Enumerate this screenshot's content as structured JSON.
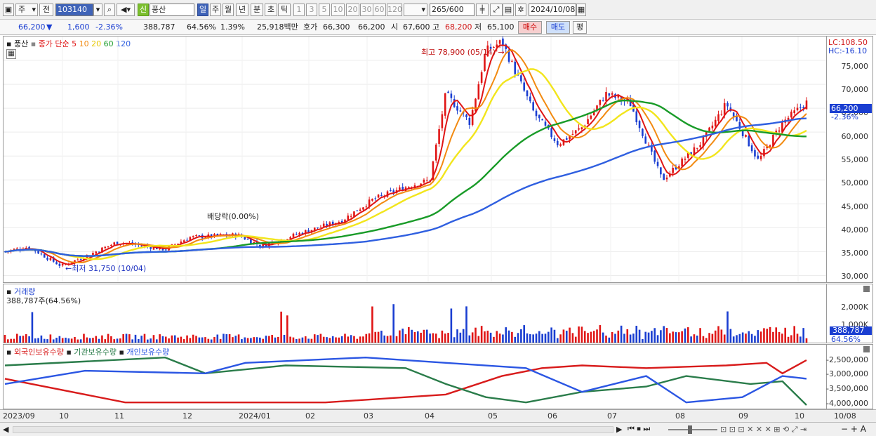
{
  "toolbar": {
    "market": "주",
    "prev_label": "전",
    "code": "103140",
    "news_badge": "신",
    "stock_name": "풍산",
    "periods": [
      "일",
      "주",
      "월",
      "년",
      "분",
      "초",
      "틱"
    ],
    "minutes": [
      "1",
      "3",
      "5",
      "10",
      "20",
      "30",
      "60",
      "120"
    ],
    "count": "265",
    "count_total": "/600",
    "date": "2024/10/08"
  },
  "quote": {
    "price": "66,200",
    "arrow": "▼",
    "change": "1,600",
    "change_pct": "-2.36%",
    "volume": "388,787",
    "vol_ratio": "64.56%",
    "turnover": "1.39%",
    "amount": "25,918백만",
    "bid_label": "호가",
    "ask": "66,300",
    "bid": "66,200",
    "open_label": "시",
    "open": "67,600",
    "high_label": "고",
    "high": "68,200",
    "low_label": "저",
    "low": "65,100",
    "buy": "매수",
    "sell": "매도",
    "eval": "평"
  },
  "price_panel": {
    "legend_name": "풍산",
    "legend_ma_label": "종가 단순",
    "ma_periods": [
      "5",
      "10",
      "20",
      "60",
      "120"
    ],
    "ma_colors": [
      "#e01515",
      "#f28a10",
      "#f2e51c",
      "#199b28",
      "#2f5fe0"
    ],
    "lc": "LC:108.50",
    "hc": "HC:-16.10",
    "current_tag": "66,200",
    "current_pct": "-2.36%",
    "high_annot": "최고 78,900 (05/14)",
    "low_annot": "최저 31,750 (10/04)",
    "dividend_annot": "배당락(0.00%)",
    "y_ticks": [
      "75,000",
      "70,000",
      "65,000",
      "60,000",
      "55,000",
      "50,000",
      "45,000",
      "40,000",
      "35,000",
      "30,000"
    ]
  },
  "volume_panel": {
    "title": "거래량",
    "value": "388,787주(64.56%)",
    "y_ticks": [
      "2,000K",
      "1,000K"
    ],
    "tag_value": "388,787",
    "tag_pct": "64.56%"
  },
  "holding_panel": {
    "legend": [
      "외국인보유수량",
      "기관보유수량",
      "개인보유수량"
    ],
    "colors": [
      "#d81b1b",
      "#2a7c4a",
      "#2b56e3"
    ],
    "y_ticks": [
      "-2,500,000",
      "-3,000,000",
      "-3,500,000",
      "-4,000,000"
    ]
  },
  "x_axis": {
    "labels": [
      "2023/09",
      "10",
      "11",
      "12",
      "2024/01",
      "02",
      "03",
      "04",
      "05",
      "06",
      "07",
      "08",
      "09",
      "10"
    ],
    "end_date": "10/08"
  },
  "chart_data": {
    "type": "candlestick",
    "title": "",
    "ylim": [
      30000,
      78900
    ],
    "price_path": [
      [
        0,
        35000
      ],
      [
        0.03,
        36000
      ],
      [
        0.07,
        32000
      ],
      [
        0.1,
        34000
      ],
      [
        0.14,
        37000
      ],
      [
        0.2,
        35500
      ],
      [
        0.23,
        38000
      ],
      [
        0.29,
        38500
      ],
      [
        0.32,
        36200
      ],
      [
        0.38,
        39500
      ],
      [
        0.42,
        41500
      ],
      [
        0.46,
        46000
      ],
      [
        0.5,
        48500
      ],
      [
        0.53,
        50000
      ],
      [
        0.55,
        68000
      ],
      [
        0.58,
        62000
      ],
      [
        0.6,
        77000
      ],
      [
        0.62,
        78900
      ],
      [
        0.66,
        64000
      ],
      [
        0.69,
        57500
      ],
      [
        0.72,
        61000
      ],
      [
        0.75,
        68000
      ],
      [
        0.78,
        66000
      ],
      [
        0.82,
        50000
      ],
      [
        0.87,
        58000
      ],
      [
        0.9,
        66000
      ],
      [
        0.94,
        54000
      ],
      [
        0.97,
        62000
      ],
      [
        1.0,
        66200
      ]
    ]
  }
}
